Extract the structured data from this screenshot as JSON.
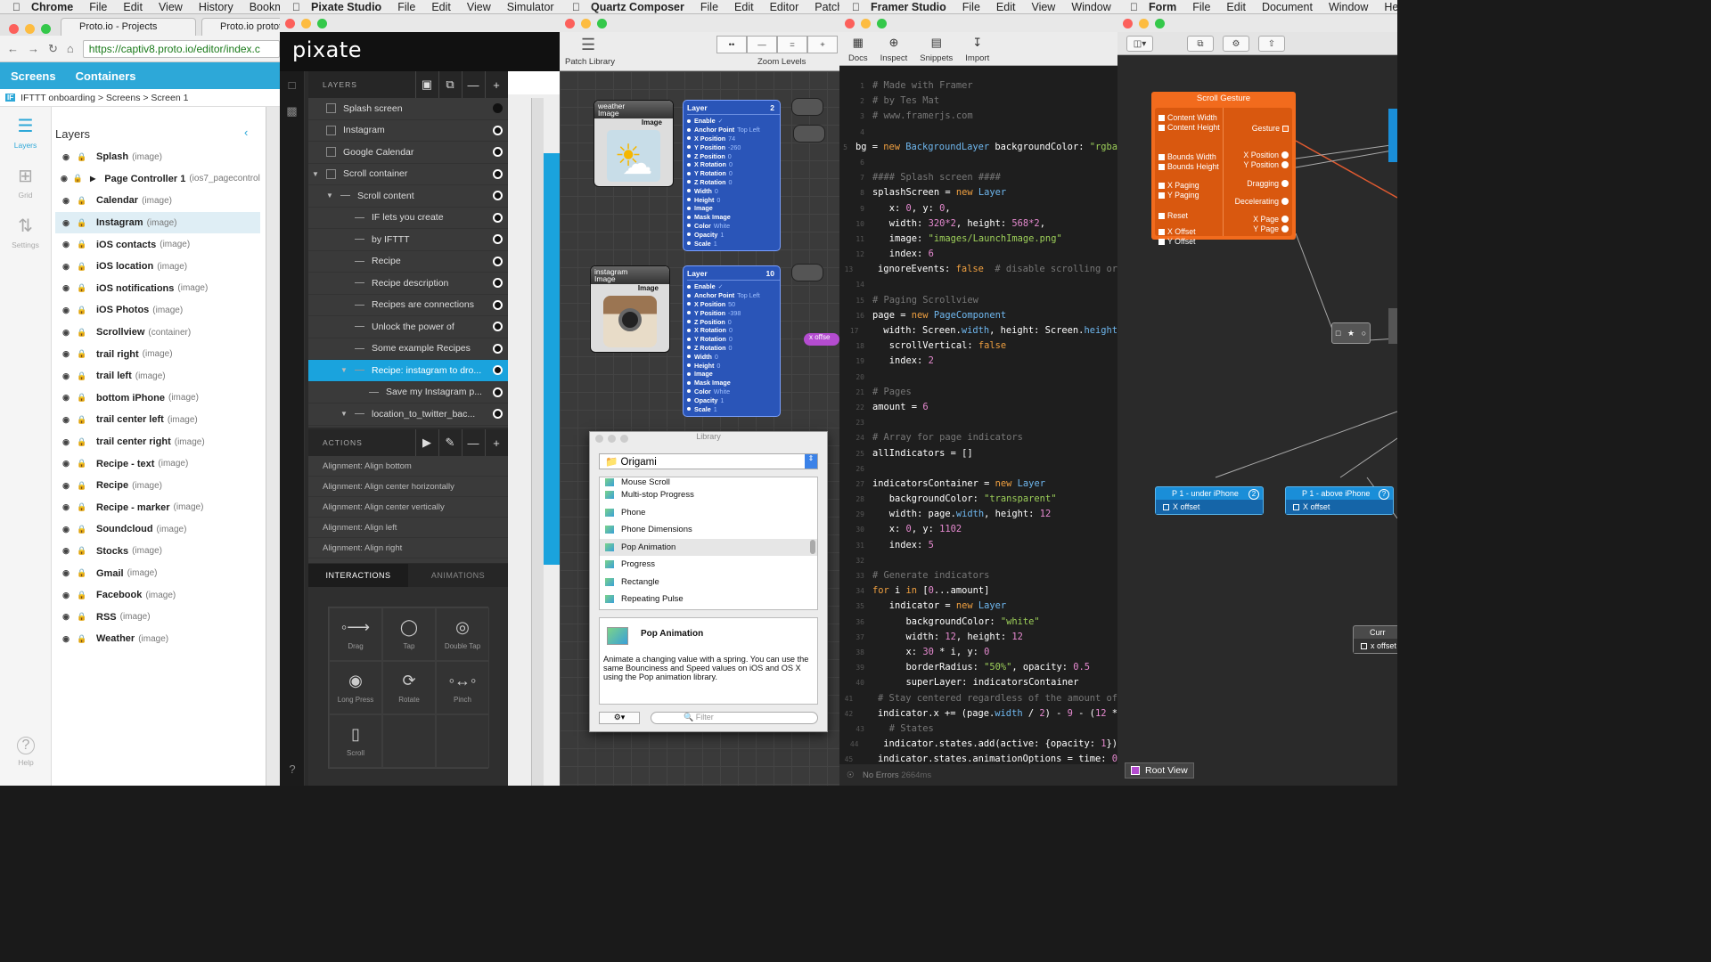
{
  "menubars": {
    "chrome": {
      "app": "Chrome",
      "items": [
        "File",
        "Edit",
        "View",
        "History",
        "Bookmar"
      ]
    },
    "pixate": {
      "app": "Pixate Studio",
      "items": [
        "File",
        "Edit",
        "View",
        "Simulator"
      ]
    },
    "quartz": {
      "app": "Quartz Composer",
      "items": [
        "File",
        "Edit",
        "Editor",
        "Patch"
      ]
    },
    "framer": {
      "app": "Framer Studio",
      "items": [
        "File",
        "Edit",
        "View",
        "Window",
        "He"
      ]
    },
    "form": {
      "app": "Form",
      "items": [
        "File",
        "Edit",
        "Document",
        "Window",
        "Help"
      ]
    }
  },
  "chrome": {
    "tabs": [
      "Proto.io - Projects",
      "Proto.io prototy"
    ],
    "url": "https://captiv8.proto.io/editor/index.c",
    "nav": {
      "screens": "Screens",
      "containers": "Containers"
    },
    "breadcrumb": "IFTTT onboarding > Screens > Screen 1",
    "if_badge": "IF",
    "sidebar": [
      {
        "label": "Layers",
        "icon": "layers-icon"
      },
      {
        "label": "Grid",
        "icon": "grid-icon"
      },
      {
        "label": "Settings",
        "icon": "settings-icon"
      },
      {
        "label": "Help",
        "icon": "help-icon"
      }
    ],
    "layers_title": "Layers",
    "layers": [
      {
        "name": "Splash",
        "type": "(image)"
      },
      {
        "name": "Page Controller 1",
        "type": "(ios7_pagecontroll..."
      },
      {
        "name": "Calendar",
        "type": "(image)"
      },
      {
        "name": "Instagram",
        "type": "(image)"
      },
      {
        "name": "iOS contacts",
        "type": "(image)"
      },
      {
        "name": "iOS location",
        "type": "(image)"
      },
      {
        "name": "iOS notifications",
        "type": "(image)"
      },
      {
        "name": "iOS Photos",
        "type": "(image)"
      },
      {
        "name": "Scrollview",
        "type": "(container)"
      },
      {
        "name": "trail right",
        "type": "(image)"
      },
      {
        "name": "trail left",
        "type": "(image)"
      },
      {
        "name": "bottom iPhone",
        "type": "(image)"
      },
      {
        "name": "trail center left",
        "type": "(image)"
      },
      {
        "name": "trail center right",
        "type": "(image)"
      },
      {
        "name": "Recipe - text",
        "type": "(image)"
      },
      {
        "name": "Recipe",
        "type": "(image)"
      },
      {
        "name": "Recipe - marker",
        "type": "(image)"
      },
      {
        "name": "Soundcloud",
        "type": "(image)"
      },
      {
        "name": "Stocks",
        "type": "(image)"
      },
      {
        "name": "Gmail",
        "type": "(image)"
      },
      {
        "name": "Facebook",
        "type": "(image)"
      },
      {
        "name": "RSS",
        "type": "(image)"
      },
      {
        "name": "Weather",
        "type": "(image)"
      }
    ]
  },
  "pixate": {
    "logo": "pixate",
    "layers_header": "LAYERS",
    "layers": [
      {
        "name": "Splash screen",
        "indent": 0
      },
      {
        "name": "Instagram",
        "indent": 0
      },
      {
        "name": "Google Calendar",
        "indent": 0
      },
      {
        "name": "Scroll container",
        "indent": 0
      },
      {
        "name": "Scroll content",
        "indent": 1
      },
      {
        "name": "IF lets you create",
        "indent": 2
      },
      {
        "name": "by IFTTT",
        "indent": 2
      },
      {
        "name": "Recipe",
        "indent": 2
      },
      {
        "name": "Recipe description",
        "indent": 2
      },
      {
        "name": "Recipes are connections",
        "indent": 2
      },
      {
        "name": "Unlock the power of",
        "indent": 2
      },
      {
        "name": "Some example Recipes",
        "indent": 2
      },
      {
        "name": "Recipe: instagram to dro...",
        "indent": 2
      },
      {
        "name": "Save my Instagram p...",
        "indent": 3
      },
      {
        "name": "location_to_twitter_bac...",
        "indent": 2
      }
    ],
    "actions_header": "ACTIONS",
    "actions": [
      "Alignment: Align bottom",
      "Alignment: Align center horizontally",
      "Alignment: Align center vertically",
      "Alignment: Align left",
      "Alignment: Align right"
    ],
    "tabs": {
      "interactions": "INTERACTIONS",
      "animations": "ANIMATIONS"
    },
    "gestures": [
      "Drag",
      "Tap",
      "Double Tap",
      "Long Press",
      "Rotate",
      "Pinch",
      "Scroll"
    ]
  },
  "quartz": {
    "patch_library": "Patch Library",
    "zoom_levels": "Zoom Levels",
    "zoom_buttons": [
      "••",
      "—",
      "=",
      "+"
    ],
    "nodes": [
      {
        "title": "weather",
        "sub": "Image",
        "port": "Image"
      },
      {
        "title": "instagram",
        "sub": "Image",
        "port": "Image"
      }
    ],
    "layer_nodes": [
      {
        "title": "Layer",
        "num": "2"
      },
      {
        "title": "Layer",
        "num": "10"
      }
    ],
    "layer_props": [
      {
        "k": "Enable",
        "v": "✓"
      },
      {
        "k": "Anchor Point",
        "v": "Top Left"
      },
      {
        "k": "X Position",
        "v": "74"
      },
      {
        "k": "Y Position",
        "v": "-260"
      },
      {
        "k": "Z Position",
        "v": "0"
      },
      {
        "k": "X Rotation",
        "v": "0"
      },
      {
        "k": "Y Rotation",
        "v": "0"
      },
      {
        "k": "Z Rotation",
        "v": "0"
      },
      {
        "k": "Width",
        "v": "0"
      },
      {
        "k": "Height",
        "v": "0"
      },
      {
        "k": "Image",
        "v": ""
      },
      {
        "k": "Mask Image",
        "v": ""
      },
      {
        "k": "Color",
        "v": "White"
      },
      {
        "k": "Opacity",
        "v": "1"
      },
      {
        "k": "Scale",
        "v": "1"
      }
    ],
    "layer_props2": [
      {
        "k": "Enable",
        "v": "✓"
      },
      {
        "k": "Anchor Point",
        "v": "Top Left"
      },
      {
        "k": "X Position",
        "v": "50"
      },
      {
        "k": "Y Position",
        "v": "-398"
      },
      {
        "k": "Z Position",
        "v": "0"
      },
      {
        "k": "X Rotation",
        "v": "0"
      },
      {
        "k": "Y Rotation",
        "v": "0"
      },
      {
        "k": "Z Rotation",
        "v": "0"
      },
      {
        "k": "Width",
        "v": "0"
      },
      {
        "k": "Height",
        "v": "0"
      },
      {
        "k": "Image",
        "v": ""
      },
      {
        "k": "Mask Image",
        "v": ""
      },
      {
        "k": "Color",
        "v": "White"
      },
      {
        "k": "Opacity",
        "v": "1"
      },
      {
        "k": "Scale",
        "v": "1"
      }
    ],
    "xoffset": "x offse",
    "library": {
      "title": "Library",
      "category": "Origami",
      "items": [
        "Mouse Scroll",
        "Multi-stop Progress",
        "Phone",
        "Phone Dimensions",
        "Pop Animation",
        "Progress",
        "Rectangle",
        "Repeating Pulse"
      ],
      "selected_title": "Pop Animation",
      "description": "Animate a changing value with a spring. You can use the same Bounciness and Speed values on iOS and OS X using the Pop animation library.",
      "filter_placeholder": "Filter"
    }
  },
  "framer": {
    "toolbar": [
      "Docs",
      "Inspect",
      "Snippets",
      "Import"
    ],
    "status": "No Errors",
    "status_time": "2664ms"
  },
  "form": {
    "gesture_title": "Scroll Gesture",
    "left_inputs": [
      "Content Width",
      "Content Height",
      "Bounds Width",
      "Bounds Height",
      "X Paging",
      "Y Paging",
      "Reset",
      "X Offset",
      "Y Offset"
    ],
    "right_outputs": [
      "Gesture",
      "X Position",
      "Y Position",
      "Dragging",
      "Decelerating",
      "X Page",
      "Y Page"
    ],
    "nodes": [
      {
        "title": "P 1 - under iPhone",
        "badge": "2",
        "port": "X offset"
      },
      {
        "title": "P 1 - above iPhone",
        "badge": "?",
        "port": "X offset"
      },
      {
        "title": "Curr",
        "badge": "",
        "port": "x offset"
      }
    ],
    "root_view": "Root View"
  }
}
